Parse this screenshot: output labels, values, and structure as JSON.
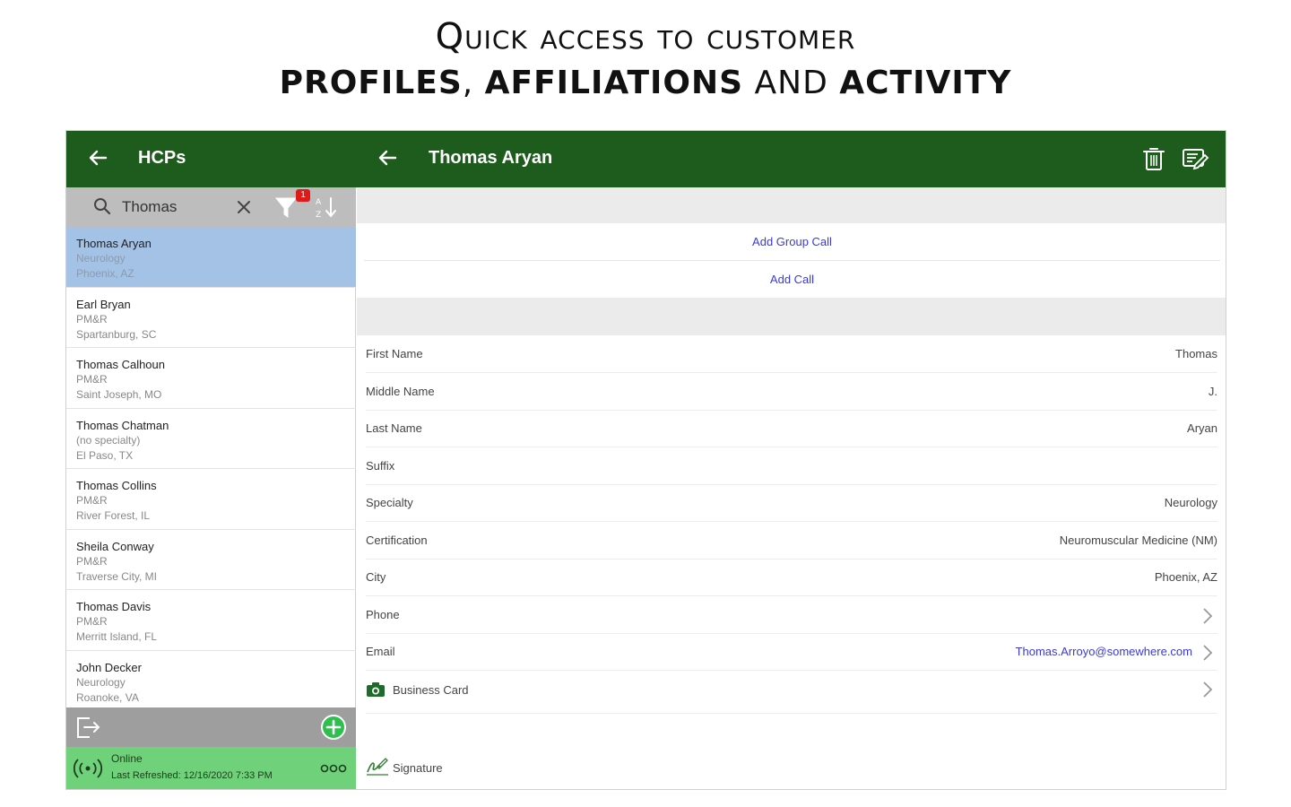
{
  "headline": {
    "line1": "Quick access to customer",
    "line2_bold1": "PROFILES",
    "line2_sep1": ", ",
    "line2_bold2": "AFFILIATIONS",
    "line2_and": " AND ",
    "line2_bold3": "ACTIVITY"
  },
  "left_header": {
    "title": "HCPs",
    "back_icon": "arrow-left-icon"
  },
  "right_header": {
    "title": "Thomas Aryan",
    "back_icon": "arrow-left-icon",
    "delete_icon": "trash-icon",
    "edit_icon": "edit-note-icon"
  },
  "search": {
    "value": "Thomas",
    "filter_badge": "1"
  },
  "hcps": [
    {
      "name": "Thomas Aryan",
      "specialty": "Neurology",
      "location": "Phoenix, AZ",
      "selected": true
    },
    {
      "name": "Earl Bryan",
      "specialty": "PM&R",
      "location": "Spartanburg, SC"
    },
    {
      "name": "Thomas Calhoun",
      "specialty": "PM&R",
      "location": "Saint Joseph, MO"
    },
    {
      "name": "Thomas Chatman",
      "specialty": "(no specialty)",
      "location": "El Paso, TX"
    },
    {
      "name": "Thomas Collins",
      "specialty": "PM&R",
      "location": "River Forest, IL"
    },
    {
      "name": "Sheila Conway",
      "specialty": "PM&R",
      "location": "Traverse City, MI"
    },
    {
      "name": "Thomas Davis",
      "specialty": "PM&R",
      "location": "Merritt Island, FL"
    },
    {
      "name": "John Decker",
      "specialty": "Neurology",
      "location": "Roanoke, VA"
    }
  ],
  "status": {
    "state": "Online",
    "refreshed": "Last Refreshed: 12/16/2020 7:33 PM"
  },
  "actions": {
    "group_call": "Add Group Call",
    "call": "Add Call"
  },
  "fields": [
    {
      "label": "First Name",
      "value": "Thomas"
    },
    {
      "label": "Middle Name",
      "value": "J."
    },
    {
      "label": "Last Name",
      "value": "Aryan"
    },
    {
      "label": "Suffix",
      "value": ""
    },
    {
      "label": "Specialty",
      "value": "Neurology"
    },
    {
      "label": "Certification",
      "value": "Neuromuscular Medicine (NM)"
    },
    {
      "label": "City",
      "value": "Phoenix, AZ"
    },
    {
      "label": "Phone",
      "value": ""
    },
    {
      "label": "Email",
      "value": "Thomas.Arroyo@somewhere.com"
    }
  ],
  "business_card": "Business Card",
  "signature": "Signature",
  "colors": {
    "header_green": "#1e5c1e",
    "status_green": "#6fd27a",
    "selected_blue": "#a3c2e6",
    "link_blue": "#3a3ad6",
    "badge_red": "#e01919"
  }
}
